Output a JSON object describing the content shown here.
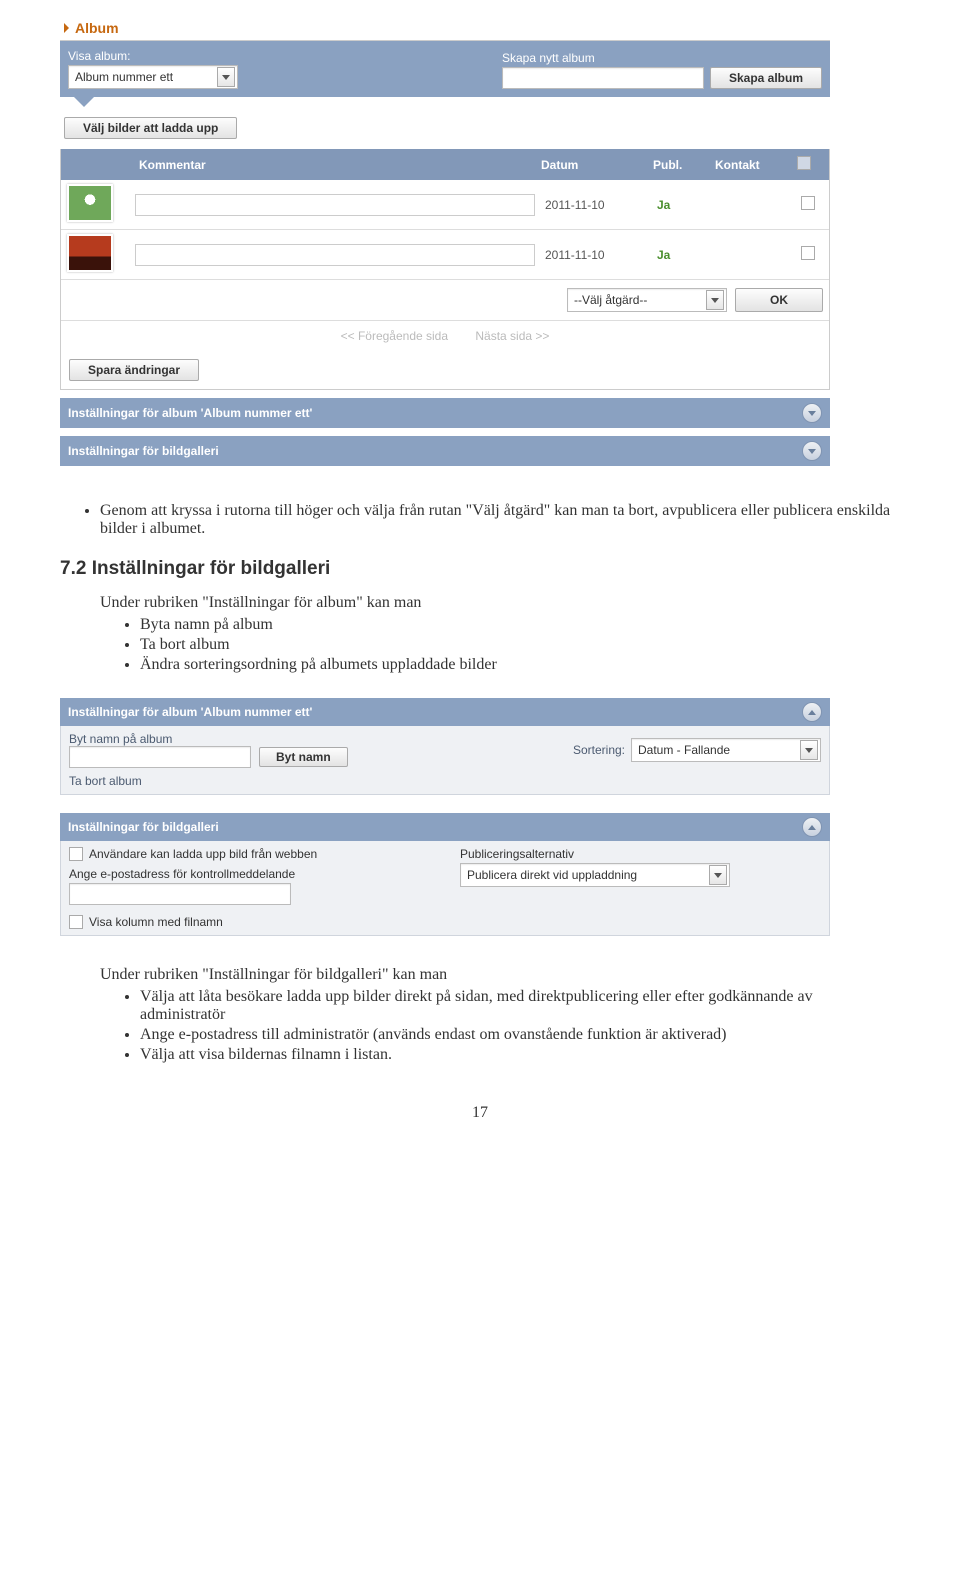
{
  "album": {
    "header": "Album",
    "visa_label": "Visa album:",
    "visa_selected": "Album nummer ett",
    "skapa_label": "Skapa nytt album",
    "skapa_btn": "Skapa album",
    "valj_bilder_btn": "Välj bilder att ladda upp",
    "thead": {
      "kommentar": "Kommentar",
      "datum": "Datum",
      "publ": "Publ.",
      "kontakt": "Kontakt"
    },
    "rows": [
      {
        "datum": "2011-11-10",
        "publ": "Ja"
      },
      {
        "datum": "2011-11-10",
        "publ": "Ja"
      }
    ],
    "action_select": "--Välj åtgärd--",
    "ok_btn": "OK",
    "pager_prev": "<< Föregående sida",
    "pager_next": "Nästa sida >>",
    "save_btn": "Spara ändringar",
    "settings_album_bar": "Inställningar för album 'Album nummer ett'",
    "settings_gallery_bar": "Inställningar för bildgalleri"
  },
  "text1": {
    "bullet": "Genom att kryssa i rutorna till höger och välja från rutan \"Välj åtgärd\" kan man ta bort, avpublicera eller publicera enskilda bilder i albumet."
  },
  "section": {
    "heading": "7.2 Inställningar för bildgalleri",
    "lead": "Under rubriken \"Inställningar för album\" kan man",
    "items": [
      "Byta namn på album",
      "Ta bort album",
      "Ändra sorteringsordning på albumets uppladdade bilder"
    ]
  },
  "ss2": {
    "title": "Inställningar för album 'Album nummer ett'",
    "byt_label": "Byt namn på album",
    "byt_btn": "Byt namn",
    "sort_label": "Sortering:",
    "sort_value": "Datum - Fallande",
    "ta_bort": "Ta bort album"
  },
  "ss3": {
    "title": "Inställningar för bildgalleri",
    "chk_anv": "Användare kan ladda upp bild från webben",
    "ange_label": "Ange e-postadress för kontrollmeddelande",
    "chk_visa": "Visa kolumn med filnamn",
    "pub_label": "Publiceringsalternativ",
    "pub_value": "Publicera direkt vid uppladdning"
  },
  "text2": {
    "lead": "Under rubriken \"Inställningar för bildgalleri\" kan man",
    "items": [
      "Välja att låta besökare ladda upp bilder direkt på sidan, med direktpublicering eller efter godkännande av administratör",
      "Ange e-postadress till administratör (används endast om ovanstående funktion är aktiverad)",
      "Välja att visa bildernas filnamn i listan."
    ]
  },
  "pagenum": "17"
}
